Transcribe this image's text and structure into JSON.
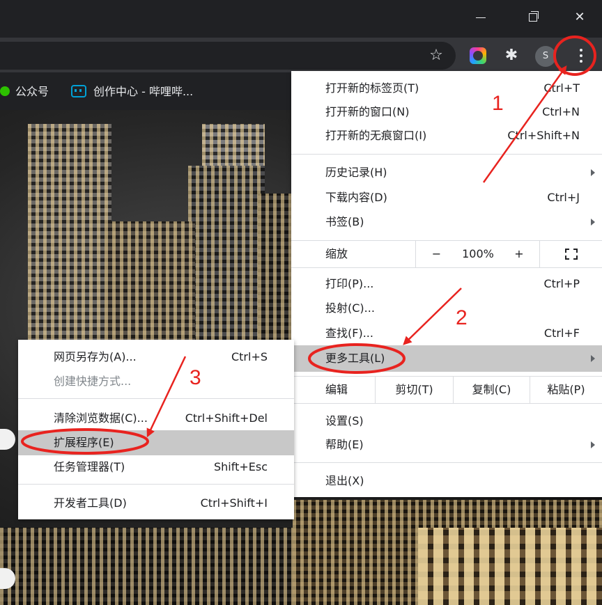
{
  "window": {
    "minimize_glyph": "",
    "maximize_glyph": "",
    "close_glyph": "✕"
  },
  "toolbar": {
    "bookmark_star_glyph": "☆",
    "puzzle_glyph": "✱",
    "avatar_letter": "S"
  },
  "bookmarks": [
    {
      "label": "公众号",
      "icon": "wechat-icon"
    },
    {
      "label": "创作中心 - 哔哩哔...",
      "icon": "bilibili-tv-icon"
    }
  ],
  "main_menu": {
    "new_tab": {
      "label": "打开新的标签页(T)",
      "shortcut": "Ctrl+T"
    },
    "new_window": {
      "label": "打开新的窗口(N)",
      "shortcut": "Ctrl+N"
    },
    "new_incognito": {
      "label": "打开新的无痕窗口(I)",
      "shortcut": "Ctrl+Shift+N"
    },
    "history": {
      "label": "历史记录(H)"
    },
    "downloads": {
      "label": "下载内容(D)",
      "shortcut": "Ctrl+J"
    },
    "bookmarks": {
      "label": "书签(B)"
    },
    "zoom": {
      "label": "缩放",
      "minus": "−",
      "value": "100%",
      "plus": "+"
    },
    "print": {
      "label": "打印(P)...",
      "shortcut": "Ctrl+P"
    },
    "cast": {
      "label": "投射(C)..."
    },
    "find": {
      "label": "查找(F)...",
      "shortcut": "Ctrl+F"
    },
    "more_tools": {
      "label": "更多工具(L)"
    },
    "edit": {
      "label": "编辑",
      "cut": "剪切(T)",
      "copy": "复制(C)",
      "paste": "粘贴(P)"
    },
    "settings": {
      "label": "设置(S)"
    },
    "help": {
      "label": "帮助(E)"
    },
    "exit": {
      "label": "退出(X)"
    }
  },
  "more_tools_menu": {
    "save_page": {
      "label": "网页另存为(A)...",
      "shortcut": "Ctrl+S"
    },
    "create_shortcut": {
      "label": "创建快捷方式..."
    },
    "clear_data": {
      "label": "清除浏览数据(C)...",
      "shortcut": "Ctrl+Shift+Del"
    },
    "extensions": {
      "label": "扩展程序(E)"
    },
    "task_manager": {
      "label": "任务管理器(T)",
      "shortcut": "Shift+Esc"
    },
    "devtools": {
      "label": "开发者工具(D)",
      "shortcut": "Ctrl+Shift+I"
    }
  },
  "annotations": {
    "step1": "1",
    "step2": "2",
    "step3": "3",
    "color": "#e8231f"
  }
}
